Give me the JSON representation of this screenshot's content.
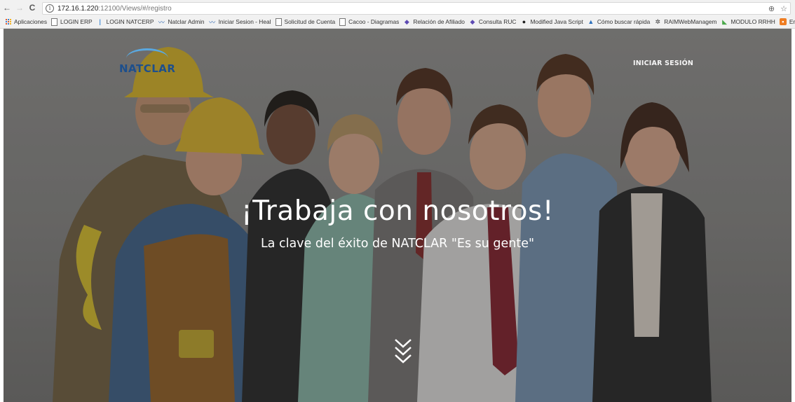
{
  "browser": {
    "back": "←",
    "forward": "→",
    "reload": "C",
    "url_host": "172.16.1.220",
    "url_path": ":12100/Views/#/registro",
    "zoom": "⊕",
    "star": "☆",
    "bookmarks": [
      {
        "label": "Aplicaciones",
        "icon": "apps-icon"
      },
      {
        "label": "LOGIN ERP",
        "icon": "page-icon"
      },
      {
        "label": "LOGIN NATCERP",
        "icon": "bar-icon"
      },
      {
        "label": "Natclar Admin",
        "icon": "wave-icon"
      },
      {
        "label": "Iniciar Sesion - Heal",
        "icon": "wave-icon"
      },
      {
        "label": "Solicitud de Cuenta",
        "icon": "page-icon"
      },
      {
        "label": "Cacoo - Diagramas",
        "icon": "page-icon"
      },
      {
        "label": "Relación de Afiliado",
        "icon": "diamond-icon"
      },
      {
        "label": "Consulta RUC",
        "icon": "diamond-icon"
      },
      {
        "label": "Modified Java Script",
        "icon": "globe-icon"
      },
      {
        "label": "Cómo buscar rápida",
        "icon": "triangle-icon"
      },
      {
        "label": "RAIMWebManagem",
        "icon": "crest-icon"
      },
      {
        "label": "MODULO RRHH",
        "icon": "green-icon"
      },
      {
        "label": "Entendiendo SQL Se",
        "icon": "orange-icon"
      }
    ]
  },
  "page": {
    "logo": "NATCLAR",
    "login": "INICIAR SESIÓN",
    "headline": "¡Trabaja con nosotros!",
    "subheadline": "La clave del éxito de NATCLAR \"Es su gente\""
  }
}
